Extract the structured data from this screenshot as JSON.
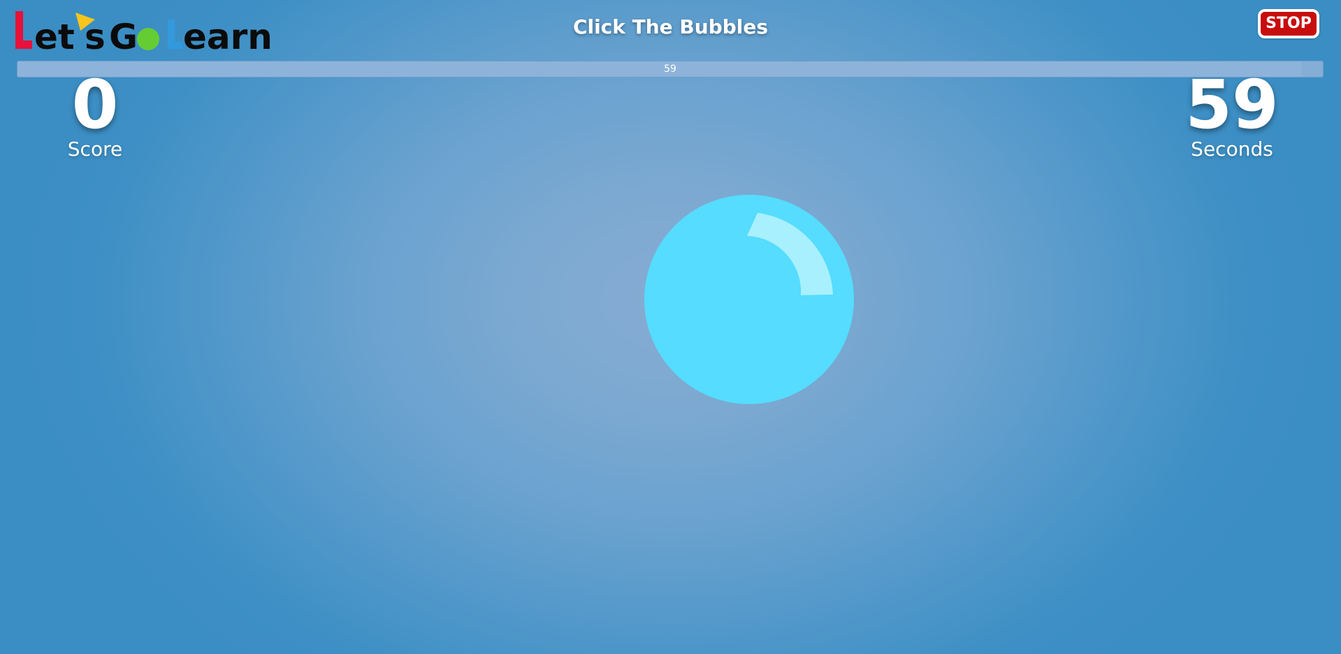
{
  "header": {
    "logo_text": "Let's Go Learn",
    "title": "Click The Bubbles",
    "stop_label": "STOP"
  },
  "progress": {
    "label": "59",
    "fraction": 0.9833
  },
  "score": {
    "value": "0",
    "label": "Score"
  },
  "timer": {
    "value": "59",
    "label": "Seconds"
  },
  "colors": {
    "bubble": "#55dcfe",
    "bubble_highlight": "#a9f0fe",
    "stop_button": "#c80d0d",
    "logo_red": "#e8113a",
    "logo_yellow": "#f7c51c",
    "logo_green": "#66cc33",
    "logo_blue": "#3399dd"
  }
}
